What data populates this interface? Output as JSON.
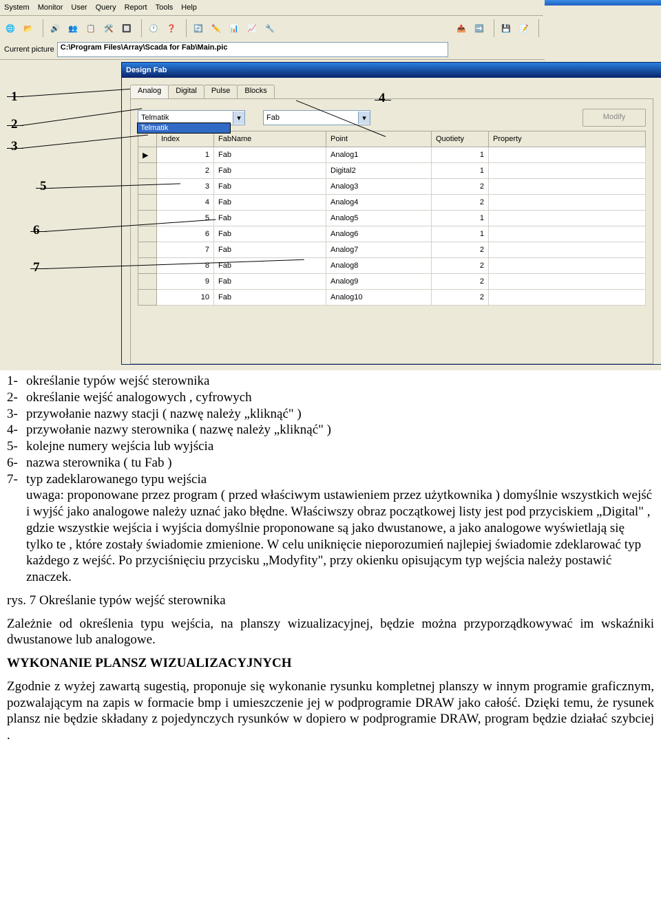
{
  "menu": [
    "System",
    "Monitor",
    "User",
    "Query",
    "Report",
    "Tools",
    "Help"
  ],
  "path_label": "Current picture",
  "path_value": "C:\\Program Files\\Array\\Scada for Fab\\Main.pic",
  "dialog_title": "Design Fab",
  "tabs": [
    "Analog",
    "Digital",
    "Pulse",
    "Blocks"
  ],
  "dd1_value": "Telmatik",
  "dd1_option": "Telmatik",
  "dd2_value": "Fab",
  "modify_label": "Modify",
  "columns": [
    "Index",
    "FabName",
    "Point",
    "Quotiety",
    "Property"
  ],
  "rows": [
    {
      "idx": 1,
      "fab": "Fab",
      "point": "Analog1",
      "q": 1
    },
    {
      "idx": 2,
      "fab": "Fab",
      "point": "Digital2",
      "q": 1
    },
    {
      "idx": 3,
      "fab": "Fab",
      "point": "Analog3",
      "q": 2
    },
    {
      "idx": 4,
      "fab": "Fab",
      "point": "Analog4",
      "q": 2
    },
    {
      "idx": 5,
      "fab": "Fab",
      "point": "Analog5",
      "q": 1
    },
    {
      "idx": 6,
      "fab": "Fab",
      "point": "Analog6",
      "q": 1
    },
    {
      "idx": 7,
      "fab": "Fab",
      "point": "Analog7",
      "q": 2
    },
    {
      "idx": 8,
      "fab": "Fab",
      "point": "Analog8",
      "q": 2
    },
    {
      "idx": 9,
      "fab": "Fab",
      "point": "Analog9",
      "q": 2
    },
    {
      "idx": 10,
      "fab": "Fab",
      "point": "Analog10",
      "q": 2
    }
  ],
  "ann_numbers": [
    "1",
    "2",
    "3",
    "5",
    "6",
    "7",
    "4"
  ],
  "legend": [
    {
      "n": "1-",
      "t": "określanie typów wejść sterownika"
    },
    {
      "n": "2-",
      "t": "określanie wejść  analogowych , cyfrowych"
    },
    {
      "n": "3-",
      "t": "przywołanie nazwy stacji ( nazwę należy „kliknąć\" )"
    },
    {
      "n": "4-",
      "t": "przywołanie nazwy sterownika ( nazwę należy „kliknąć\" )"
    },
    {
      "n": "5-",
      "t": "kolejne numery  wejścia lub wyjścia"
    },
    {
      "n": "6-",
      "t": "nazwa sterownika ( tu Fab )"
    },
    {
      "n": "7-",
      "t": "typ zadeklarowanego typu wejścia"
    }
  ],
  "legend_note": "uwaga: proponowane przez program ( przed właściwym  ustawieniem przez użytkownika )  domyślnie wszystkich  wejść i wyjść  jako analogowe  należy uznać jako błędne.  Właściwszy obraz początkowej listy jest pod przyciskiem  „Digital\" , gdzie wszystkie wejścia i wyjścia domyślnie proponowane są  jako dwustanowe, a  jako analogowe wyświetlają się tylko te , które zostały  świadomie zmienione. W celu uniknięcie nieporozumień najlepiej świadomie zdeklarować typ każdego z wejść. Po przyciśnięciu przycisku „Modyfity\", przy okienku opisującym typ wejścia należy postawić znaczek.",
  "caption": "rys. 7 Określanie typów wejść sterownika",
  "para1": "Zależnie od określenia typu wejścia, na planszy wizualizacyjnej, będzie można przyporządkowywać im wskaźniki dwustanowe lub analogowe.",
  "heading": "WYKONANIE PLANSZ WIZUALIZACYJNYCH",
  "para2": "Zgodnie z wyżej zawartą sugestią, proponuje się wykonanie rysunku kompletnej planszy w innym programie graficznym, pozwalającym na zapis w formacie bmp i umieszczenie jej w podprogramie DRAW jako całość. Dzięki temu, że rysunek plansz  nie będzie  składany z pojedynczych rysunków  w dopiero w podprogramie DRAW,  program będzie działać szybciej ."
}
